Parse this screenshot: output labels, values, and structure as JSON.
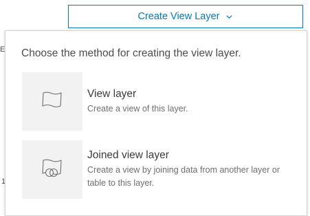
{
  "header": {
    "create_button_label": "Create View Layer"
  },
  "background": {
    "edge_text_1": "E",
    "edge_text_2": "1"
  },
  "dropdown": {
    "intro": "Choose the method for creating the view layer.",
    "options": [
      {
        "title": "View layer",
        "description": "Create a view of this layer.",
        "icon": "layer-icon"
      },
      {
        "title": "Joined view layer",
        "description": "Create a view by joining data from another layer or table to this layer.",
        "icon": "join-layer-icon"
      }
    ]
  },
  "colors": {
    "accent": "#0079c1",
    "thumb_bg": "#f2f2f2"
  }
}
